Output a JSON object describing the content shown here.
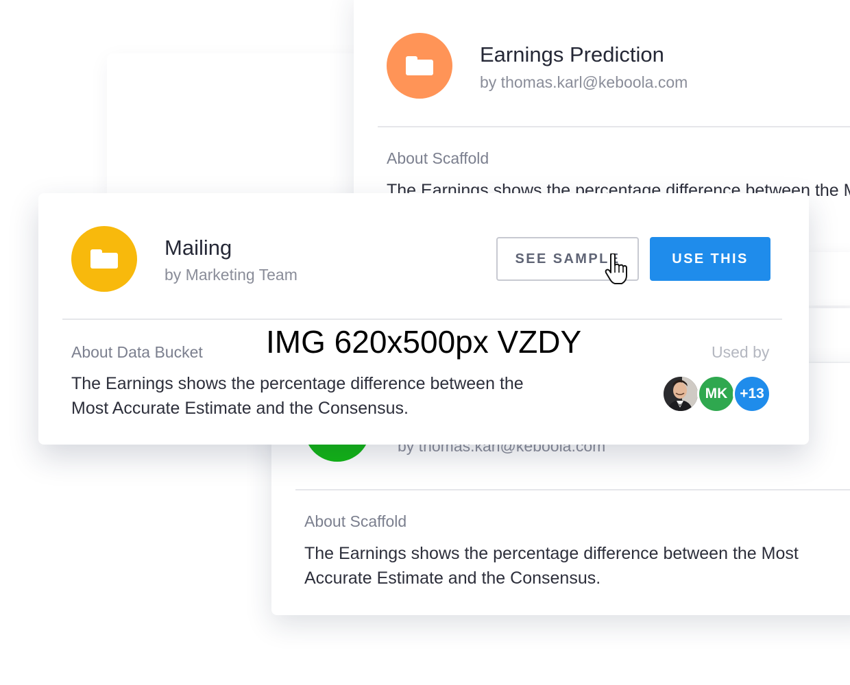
{
  "cards": {
    "top": {
      "title": "Earnings Prediction",
      "byline": "by thomas.karl@keboola.com",
      "section_label": "About Scaffold",
      "description": "The Earnings shows the percentage difference between the Most Accurate Estimate and the Consensus.",
      "icon_color": "#ff9457",
      "icon": "folder-icon"
    },
    "main": {
      "title": "Mailing",
      "byline": "by Marketing Team",
      "section_label": "About Data Bucket",
      "description_line1": "The Earnings shows the percentage difference between the",
      "description_line2": "Most Accurate Estimate and the Consensus.",
      "icon_color": "#f8b90c",
      "icon": "folder-icon",
      "see_sample_label": "SEE SAMPLE",
      "use_this_label": "USE THIS",
      "used_by_label": "Used by",
      "used_by": [
        {
          "kind": "photo",
          "initials": ""
        },
        {
          "kind": "initials",
          "initials": "MK",
          "color": "#2fa84f"
        },
        {
          "kind": "count",
          "initials": "+13",
          "color": "#1f8ceb"
        }
      ]
    },
    "bottom": {
      "byline": "by thomas.karl@keboola.com",
      "section_label": "About Scaffold",
      "description_line1": "The Earnings shows the percentage difference between the Most",
      "description_line2": "Accurate Estimate and the Consensus.",
      "icon_color": "#12b715"
    }
  },
  "watermark": "IMG 620x500px VZDY",
  "colors": {
    "primary": "#1f8ceb",
    "text": "#252836",
    "muted": "#8a8d99"
  }
}
